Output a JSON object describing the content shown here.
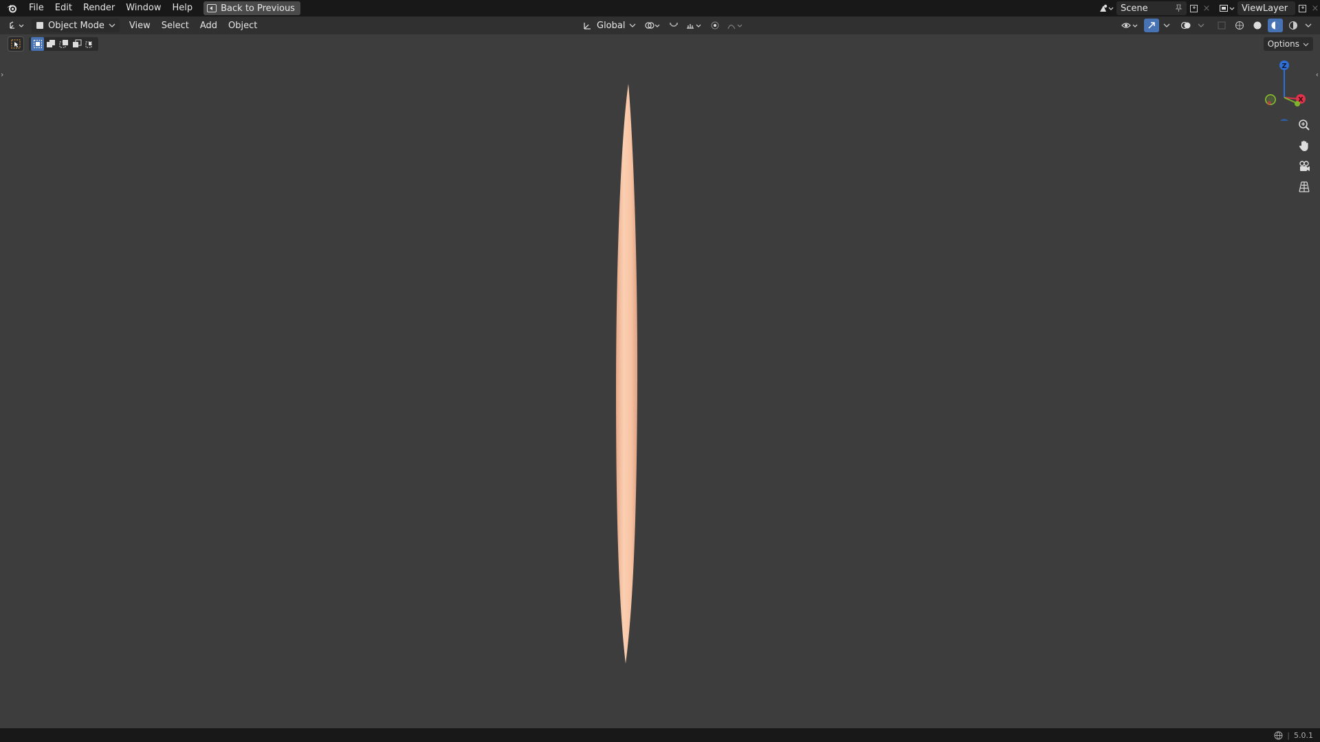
{
  "topbar": {
    "menu": [
      "File",
      "Edit",
      "Render",
      "Window",
      "Help"
    ],
    "back_button": "Back to Previous",
    "scene": "Scene",
    "view_layer": "ViewLayer"
  },
  "header": {
    "mode": "Object Mode",
    "menus": [
      "View",
      "Select",
      "Add",
      "Object"
    ],
    "orientation": "Global",
    "options": "Options"
  },
  "gizmo": {
    "z": "Z",
    "x": "X"
  },
  "status": {
    "version": "5.0.1"
  },
  "colors": {
    "object": "#f5c0a0",
    "axis_x": "#e0334b",
    "axis_y": "#7fb32e",
    "axis_z": "#2f6fd8"
  }
}
